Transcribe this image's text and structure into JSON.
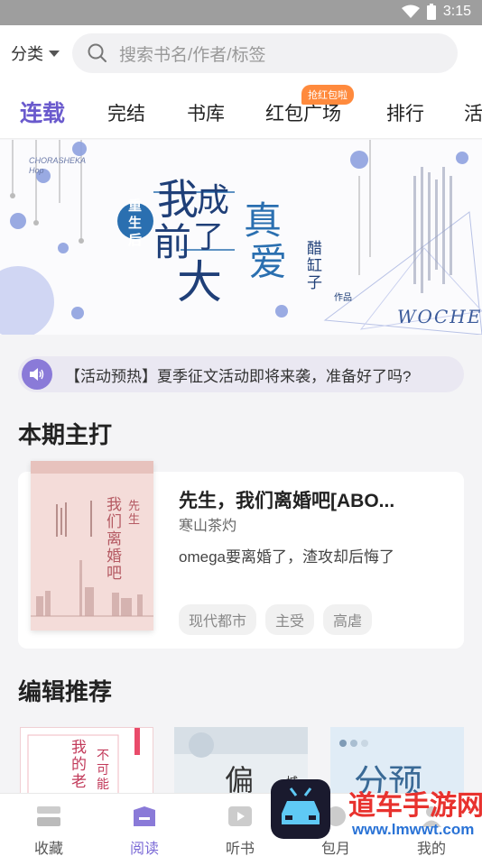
{
  "status_bar": {
    "time": "3:15"
  },
  "topbar": {
    "category_label": "分类",
    "search_placeholder": "搜索书名/作者/标签"
  },
  "tabs": [
    {
      "label": "连载",
      "active": true
    },
    {
      "label": "完结"
    },
    {
      "label": "书库"
    },
    {
      "label": "红包广场",
      "badge": "抢红包啦"
    },
    {
      "label": "排行"
    },
    {
      "label": "活"
    }
  ],
  "banner": {
    "title_chars": [
      "我",
      "成",
      "了",
      "前",
      "大",
      "真",
      "爱"
    ],
    "seal": [
      "重",
      "生",
      "后"
    ],
    "author": "醋缸子",
    "author_suffix": "作品",
    "deco_small": "CHORASHEKA Hop",
    "deco_right": "WOCHE"
  },
  "notice": {
    "text": "【活动预热】夏季征文活动即将来袭，准备好了吗?"
  },
  "section_featured": {
    "heading": "本期主打"
  },
  "featured_book": {
    "title": "先生，我们离婚吧[ABO...",
    "author": "寒山茶灼",
    "description": "omega要离婚了，渣攻却后悔了",
    "tags": [
      "现代都市",
      "主受",
      "高虐"
    ],
    "cover_text": [
      "先生",
      "我们离婚吧"
    ]
  },
  "section_editor": {
    "heading": "编辑推荐"
  },
  "recommend_covers": [
    {
      "text": "我的老",
      "text2": "不可能"
    },
    {
      "text": "偏",
      "text2": "城"
    },
    {
      "text": "分预"
    }
  ],
  "bottom_nav": [
    {
      "label": "收藏",
      "icon": "bookshelf-icon"
    },
    {
      "label": "阅读",
      "icon": "read-icon",
      "active": true
    },
    {
      "label": "听书",
      "icon": "play-icon"
    },
    {
      "label": "包月",
      "icon": "vip-icon"
    },
    {
      "label": "我的",
      "icon": "user-icon"
    }
  ],
  "watermark": {
    "text": "道车手游网",
    "url": "www.lmwwt.com"
  },
  "colors": {
    "accent": "#6a5acd",
    "badge": "#ff8a3d",
    "status_bar": "#9e9e9e"
  }
}
